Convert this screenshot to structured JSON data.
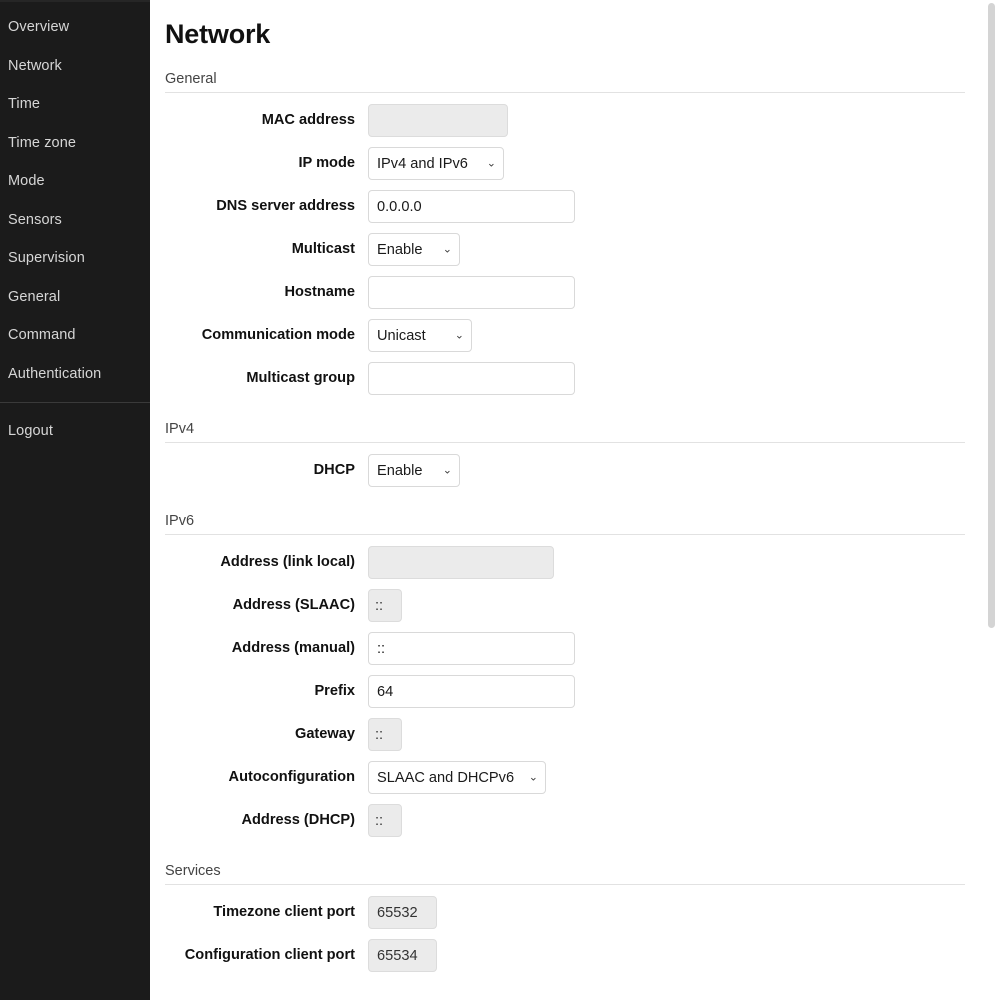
{
  "sidebar": {
    "items": [
      {
        "label": "Overview"
      },
      {
        "label": "Network"
      },
      {
        "label": "Time"
      },
      {
        "label": "Time zone"
      },
      {
        "label": "Mode"
      },
      {
        "label": "Sensors"
      },
      {
        "label": "Supervision"
      },
      {
        "label": "General"
      },
      {
        "label": "Command"
      },
      {
        "label": "Authentication"
      }
    ],
    "logout": {
      "label": "Logout"
    }
  },
  "page": {
    "title": "Network"
  },
  "sections": {
    "general": {
      "heading": "General",
      "mac_address": {
        "label": "MAC address",
        "value": ""
      },
      "ip_mode": {
        "label": "IP mode",
        "value": "IPv4 and IPv6"
      },
      "dns_server_address": {
        "label": "DNS server address",
        "value": "0.0.0.0"
      },
      "multicast": {
        "label": "Multicast",
        "value": "Enable"
      },
      "hostname": {
        "label": "Hostname",
        "value": ""
      },
      "communication_mode": {
        "label": "Communication mode",
        "value": "Unicast"
      },
      "multicast_group": {
        "label": "Multicast group",
        "value": ""
      }
    },
    "ipv4": {
      "heading": "IPv4",
      "dhcp": {
        "label": "DHCP",
        "value": "Enable"
      }
    },
    "ipv6": {
      "heading": "IPv6",
      "address_link_local": {
        "label": "Address (link local)",
        "value": ""
      },
      "address_slaac": {
        "label": "Address (SLAAC)",
        "value": "::"
      },
      "address_manual": {
        "label": "Address (manual)",
        "value": "::"
      },
      "prefix": {
        "label": "Prefix",
        "value": "64"
      },
      "gateway": {
        "label": "Gateway",
        "value": "::"
      },
      "autoconfiguration": {
        "label": "Autoconfiguration",
        "value": "SLAAC and DHCPv6"
      },
      "address_dhcp": {
        "label": "Address (DHCP)",
        "value": "::"
      }
    },
    "services": {
      "heading": "Services",
      "timezone_client_port": {
        "label": "Timezone client port",
        "value": "65532"
      },
      "configuration_client_port": {
        "label": "Configuration client port",
        "value": "65534"
      }
    }
  },
  "icons": {
    "chevron_down": "⌄"
  },
  "colors": {
    "sidebar_bg": "#1b1b1b",
    "sidebar_text": "#d6d6d6",
    "page_bg": "#ffffff",
    "label_text": "#111111",
    "readonly_field_bg": "#ebebeb",
    "rule": "#e2e2e2",
    "scrollbar_thumb": "#d4d4d4"
  }
}
